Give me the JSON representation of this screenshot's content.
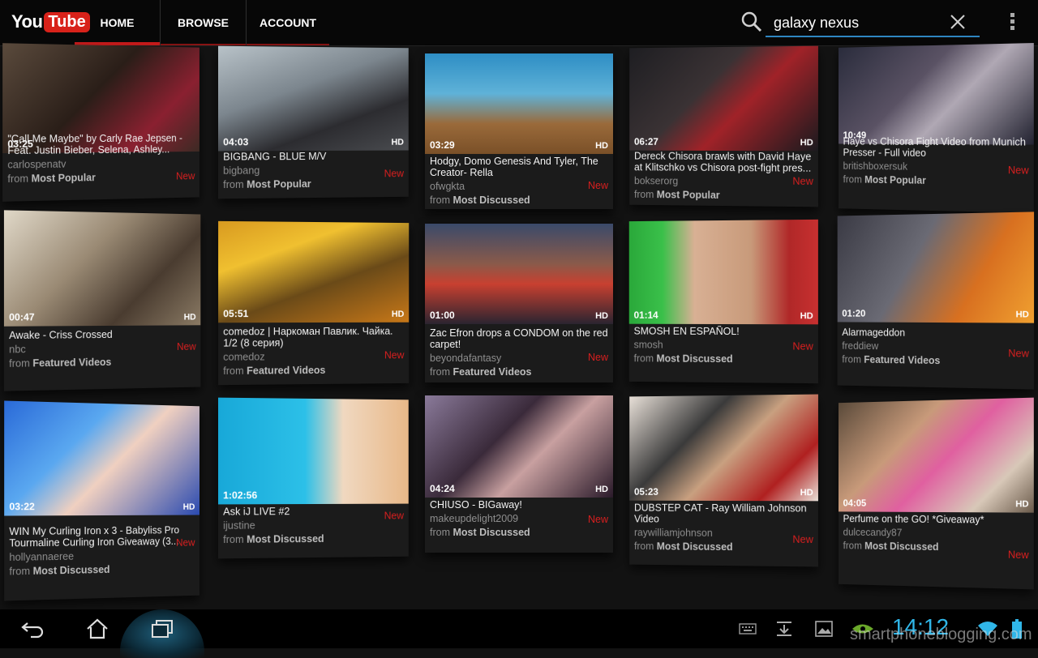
{
  "header": {
    "logo_you": "You",
    "logo_tube": "Tube",
    "tabs": [
      {
        "label": "HOME",
        "active": true
      },
      {
        "label": "BROWSE",
        "active": false
      },
      {
        "label": "ACCOUNT",
        "active": false
      }
    ],
    "search_value": "galaxy nexus"
  },
  "videos": [
    {
      "duration": "03:25",
      "hd": "",
      "title": "\"Call Me Maybe\" by Carly Rae Jepsen - Feat. Justin Bieber, Selena, Ashley...",
      "channel": "carlospenatv",
      "from_prefix": "from",
      "from_feed": "Most Popular",
      "new": "New"
    },
    {
      "duration": "04:03",
      "hd": "HD",
      "title": "BIGBANG - BLUE M/V",
      "channel": "bigbang",
      "from_prefix": "from",
      "from_feed": "Most Popular",
      "new": "New"
    },
    {
      "duration": "03:29",
      "hd": "HD",
      "title": "Hodgy, Domo Genesis And Tyler, The Creator- Rella",
      "channel": "ofwgkta",
      "from_prefix": "from",
      "from_feed": "Most Discussed",
      "new": "New"
    },
    {
      "duration": "06:27",
      "hd": "HD",
      "title": "Dereck Chisora brawls with David Haye at Klitschko vs Chisora post-fight pres...",
      "channel": "bokserorg",
      "from_prefix": "from",
      "from_feed": "Most Popular",
      "new": "New"
    },
    {
      "duration": "10:49",
      "hd": "",
      "title": "Haye vs Chisora Fight Video from Munich Presser - Full video",
      "channel": "britishboxersuk",
      "from_prefix": "from",
      "from_feed": "Most Popular",
      "new": "New"
    },
    {
      "duration": "00:47",
      "hd": "HD",
      "title": "Awake - Criss Crossed",
      "channel": "nbc",
      "from_prefix": "from",
      "from_feed": "Featured Videos",
      "new": "New"
    },
    {
      "duration": "05:51",
      "hd": "HD",
      "title": "comedoz | Наркоман Павлик. Чайка. 1/2 (8 серия)",
      "channel": "comedoz",
      "from_prefix": "from",
      "from_feed": "Featured Videos",
      "new": "New"
    },
    {
      "duration": "01:00",
      "hd": "HD",
      "title": "Zac Efron drops a CONDOM on the red carpet!",
      "channel": "beyondafantasy",
      "from_prefix": "from",
      "from_feed": "Featured Videos",
      "new": "New"
    },
    {
      "duration": "01:14",
      "hd": "HD",
      "title": "SMOSH EN ESPAÑOL!",
      "channel": "smosh",
      "from_prefix": "from",
      "from_feed": "Most Discussed",
      "new": "New"
    },
    {
      "duration": "01:20",
      "hd": "HD",
      "title": "Alarmageddon",
      "channel": "freddiew",
      "from_prefix": "from",
      "from_feed": "Featured Videos",
      "new": "New"
    },
    {
      "duration": "03:22",
      "hd": "HD",
      "title": "WIN My Curling Iron x 3 - Babyliss Pro Tourmaline Curling Iron Giveaway (3...",
      "channel": "hollyannaeree",
      "from_prefix": "from",
      "from_feed": "Most Discussed",
      "new": "New"
    },
    {
      "duration": "1:02:56",
      "hd": "",
      "title": "Ask iJ LIVE #2",
      "channel": "ijustine",
      "from_prefix": "from",
      "from_feed": "Most Discussed",
      "new": "New"
    },
    {
      "duration": "04:24",
      "hd": "HD",
      "title": "CHIUSO - BIGaway!",
      "channel": "makeupdelight2009",
      "from_prefix": "from",
      "from_feed": "Most Discussed",
      "new": "New"
    },
    {
      "duration": "05:23",
      "hd": "HD",
      "title": "DUBSTEP CAT - Ray William Johnson Video",
      "channel": "raywilliamjohnson",
      "from_prefix": "from",
      "from_feed": "Most Discussed",
      "new": "New"
    },
    {
      "duration": "04:05",
      "hd": "HD",
      "title": "Perfume on the GO! *Giveaway*",
      "channel": "dulcecandy87",
      "from_prefix": "from",
      "from_feed": "Most Discussed",
      "new": "New"
    }
  ],
  "status": {
    "time": "14:12",
    "watermark": "smartphoneblogging.com"
  },
  "colors": {
    "accent_red": "#cc1b1b",
    "search_underline": "#2e86c1",
    "clock_blue": "#30b6e8"
  }
}
